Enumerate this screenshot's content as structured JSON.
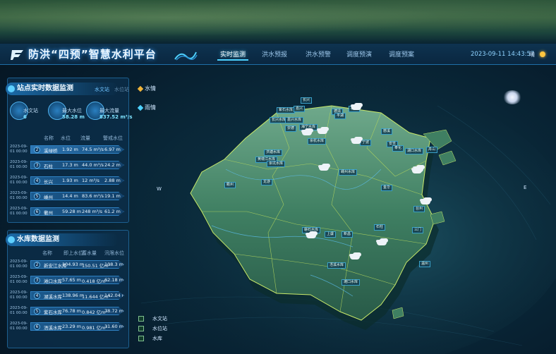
{
  "header": {
    "title": "防洪“四预”智慧水利平台",
    "nav": [
      "实时监测",
      "洪水预报",
      "洪水预警",
      "调度预演",
      "调度预案"
    ],
    "active_nav": 0,
    "datetime": "2023-09-11 14:43:57",
    "weather": "晴"
  },
  "side_tabs": [
    "水情",
    "雨情"
  ],
  "panel1": {
    "title": "站点实时数据监测",
    "tabs": [
      "水文站",
      "水位站"
    ],
    "stats": [
      {
        "label": "水文站",
        "value": "6"
      },
      {
        "label": "最大水位",
        "value": "58.28 m"
      },
      {
        "label": "最大流量",
        "value": "837.52 m³/s"
      }
    ],
    "columns": [
      "名称",
      "水位",
      "流量",
      "警戒水位"
    ],
    "rows": [
      {
        "date": "2023-09-01 00:00",
        "no": "2",
        "name": "溪绿桥",
        "level": "1.92 m",
        "flow": "74.5 m³/s",
        "warn": "6.97 m"
      },
      {
        "date": "2023-09-01 00:00",
        "no": "3",
        "name": "石柱",
        "level": "17.3 m",
        "flow": "44.0 m³/s",
        "warn": "24.2 m"
      },
      {
        "date": "2023-09-01 00:00",
        "no": "4",
        "name": "长兴",
        "level": "1.93 m",
        "flow": "12 m³/s",
        "warn": "2.88 m"
      },
      {
        "date": "2023-09-01 00:00",
        "no": "5",
        "name": "嵊州",
        "level": "14.4 m",
        "flow": "83.6 m³/s",
        "warn": "19.1 m"
      },
      {
        "date": "2023-09-01 00:00",
        "no": "6",
        "name": "衢州",
        "level": "59.28 m",
        "flow": "248 m³/s",
        "warn": "61.2 m"
      }
    ]
  },
  "panel2": {
    "title": "水库数据监测",
    "columns": [
      "名称",
      "即上水位",
      "蓄水量",
      "汛限水位"
    ],
    "rows": [
      {
        "date": "2023-09-01 00:00",
        "no": "2",
        "name": "新安江水库",
        "level": "104.93 m",
        "storage": "150.51 亿m³",
        "limit": "108.3 m"
      },
      {
        "date": "2023-09-01 00:00",
        "no": "3",
        "name": "滩口水库",
        "level": "57.65 m",
        "storage": "0.418 亿m³",
        "limit": "62.18 m"
      },
      {
        "date": "2023-09-01 00:00",
        "no": "4",
        "name": "湖溪水库",
        "level": "138.96 m",
        "storage": "11.644 亿m³",
        "limit": "142.04 m"
      },
      {
        "date": "2023-09-01 00:00",
        "no": "5",
        "name": "紫石水库",
        "level": "76.78 m",
        "storage": "0.842 亿m³",
        "limit": "78.72 m"
      },
      {
        "date": "2023-09-01 00:00",
        "no": "6",
        "name": "浯溪水库",
        "level": "23.29 m",
        "storage": "0.981 亿m³",
        "limit": "31.60 m"
      }
    ]
  },
  "legend": [
    "水文站",
    "水位站",
    "水库"
  ],
  "compass": {
    "west": "W",
    "east": "E"
  },
  "map_labels": [
    "长兴",
    "紫石水库",
    "嘉兴",
    "德清",
    "长兴水库",
    "嘉兴水库",
    "崇德",
    "海宁水库",
    "平湖",
    "杭州",
    "余杭水库",
    "洪塘水库",
    "宁波",
    "黄墩江水库",
    "余坑水库",
    "嵊州水库",
    "衢州",
    "龙游",
    "安吉",
    "湖口水库",
    "金华",
    "浯溪水库",
    "台州",
    "三门",
    "磐石水库",
    "上虞",
    "新昌",
    "石柱",
    "温州",
    "滩口水库",
    "舟山",
    "慈溪",
    "奉化"
  ]
}
